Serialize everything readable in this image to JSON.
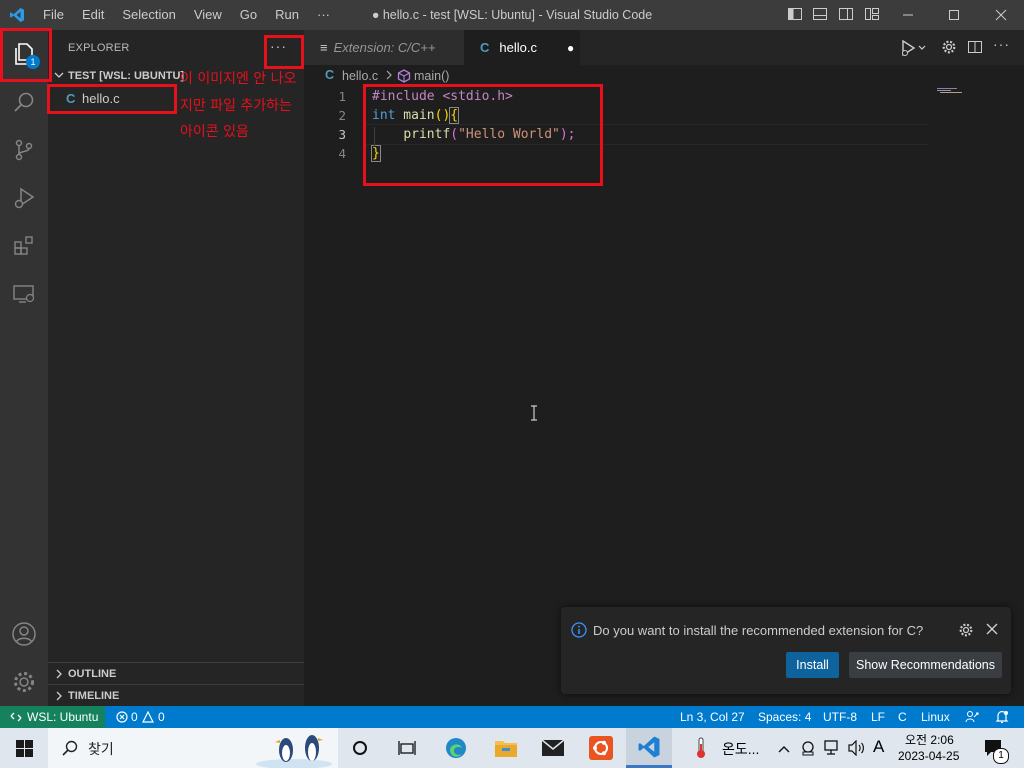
{
  "window": {
    "title": "● hello.c - test [WSL: Ubuntu] - Visual Studio Code",
    "menu": [
      "File",
      "Edit",
      "Selection",
      "View",
      "Go",
      "Run",
      "···"
    ]
  },
  "activity_bar": {
    "explorer_badge": "1",
    "items": [
      "explorer-icon",
      "search-icon",
      "source-control-icon",
      "run-debug-icon",
      "extensions-icon",
      "remote-explorer-icon",
      "account-icon",
      "manage-gear-icon"
    ]
  },
  "sidebar": {
    "title": "EXPLORER",
    "more_label": "···",
    "folder": "TEST [WSL: UBUNTU]",
    "files": [
      {
        "icon_label": "C",
        "name": "hello.c"
      }
    ],
    "outline": "OUTLINE",
    "timeline": "TIMELINE"
  },
  "annotation": {
    "line1": "이 이미지엔 안 나오",
    "line2": "지만 파일 추가하는",
    "line3": "아이콘 있음"
  },
  "tabs": [
    {
      "label": "Extension: C/C++",
      "icon": "≡"
    },
    {
      "label": "hello.c",
      "icon": "C",
      "modified": "●"
    }
  ],
  "breadcrumb": {
    "file": "hello.c",
    "symbol": "main()"
  },
  "editor": {
    "line_numbers": [
      "1",
      "2",
      "3",
      "4"
    ],
    "lines": {
      "l1": "#include <stdio.h>",
      "l2_kw": "int",
      "l2_fn": " main",
      "l2_p": "()",
      "l2_b": "{",
      "l3_indent": "    ",
      "l3_fn": "printf",
      "l3_open": "(",
      "l3_str": "\"Hello World\"",
      "l3_close": ");",
      "l4": "}"
    }
  },
  "notification": {
    "message": "Do you want to install the recommended extension for C?",
    "install": "Install",
    "show": "Show Recommendations"
  },
  "status_bar": {
    "remote": "WSL: Ubuntu",
    "errors": "0",
    "warnings": "0",
    "position": "Ln 3, Col 27",
    "spaces": "Spaces: 4",
    "encoding": "UTF-8",
    "eol": "LF",
    "language": "C",
    "os": "Linux"
  },
  "taskbar": {
    "search": "찾기",
    "weather": "온도...",
    "ime": "A",
    "time_period": "오전 2:06",
    "date": "2023-04-25",
    "notification_count": "1"
  },
  "colors": {
    "accent": "#007acc",
    "annotation": "#e8101a"
  }
}
